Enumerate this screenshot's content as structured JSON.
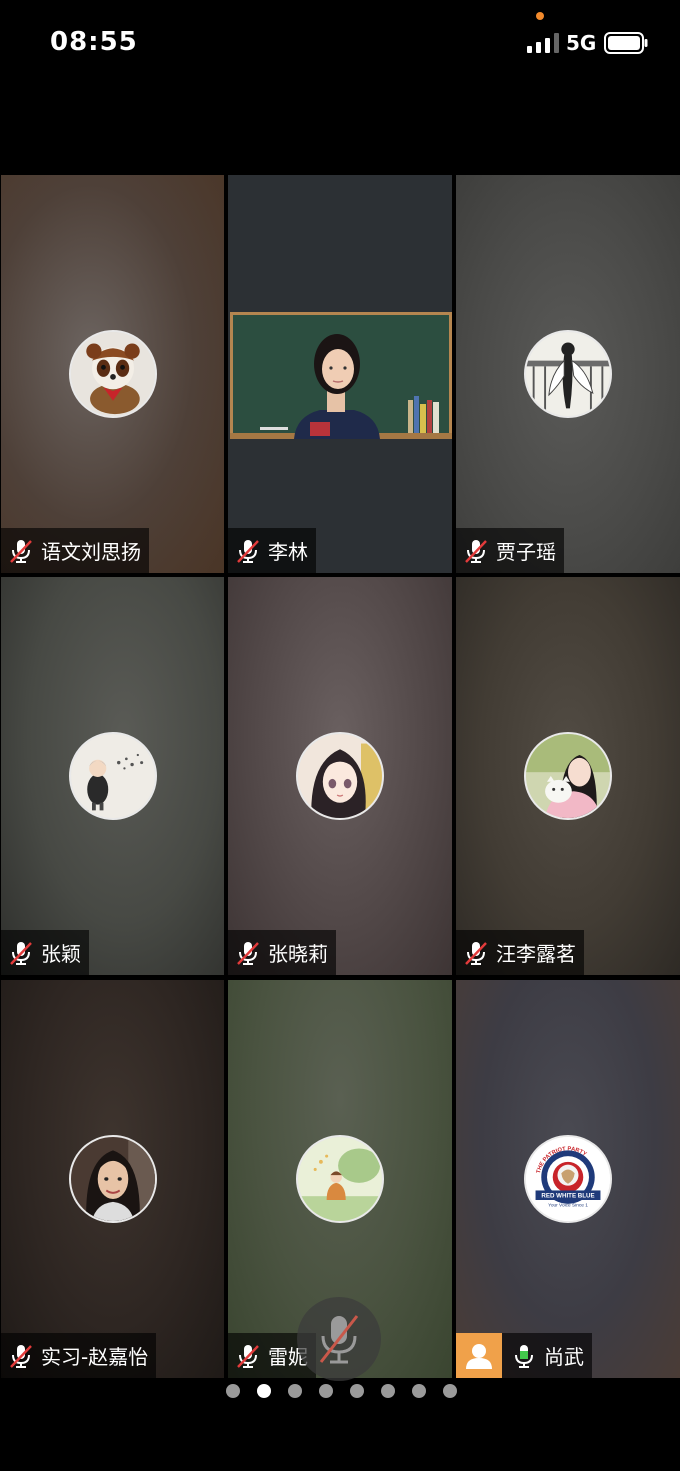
{
  "status_bar": {
    "time": "08:55",
    "network": "5G",
    "icons": [
      "cellular-signal-icon",
      "battery-icon"
    ],
    "recording_dot_color": "#f28a2c"
  },
  "participants": [
    {
      "name": "语文刘思扬",
      "mic": "muted",
      "avatar": "red-panda-plush",
      "bg": "#5a4a3e"
    },
    {
      "name": "李林",
      "mic": "muted",
      "video": "classroom-camera-feed",
      "bg": "#2c3034"
    },
    {
      "name": "贾子瑶",
      "mic": "muted",
      "avatar": "ink-drawing-figure",
      "bg": "#4a4a48"
    },
    {
      "name": "张颖",
      "mic": "muted",
      "avatar": "cartoon-child-bubbles",
      "bg": "#3e403c"
    },
    {
      "name": "张晓莉",
      "mic": "muted",
      "avatar": "anime-girl",
      "bg": "#4d4444"
    },
    {
      "name": "汪李露茗",
      "mic": "muted",
      "avatar": "girl-with-cat",
      "bg": "#3f3a33"
    },
    {
      "name": "实习-赵嘉怡",
      "mic": "muted",
      "avatar": "young-woman-photo",
      "bg": "#2e2622"
    },
    {
      "name": "雷妮",
      "mic": "muted",
      "avatar": "illustrated-child-garden",
      "bg": "#45503c"
    },
    {
      "name": "尚武",
      "mic": "active",
      "host": true,
      "avatar": "patriot-party-logo",
      "bg": "#3d3c44"
    }
  ],
  "logo_text": {
    "top": "THE PATRIOT PARTY",
    "banner": "RED WHITE BLUE",
    "bottom": "Your Voice Since 1"
  },
  "pager": {
    "total": 8,
    "active": 2
  },
  "controls": {
    "mic_button_state": "muted"
  }
}
